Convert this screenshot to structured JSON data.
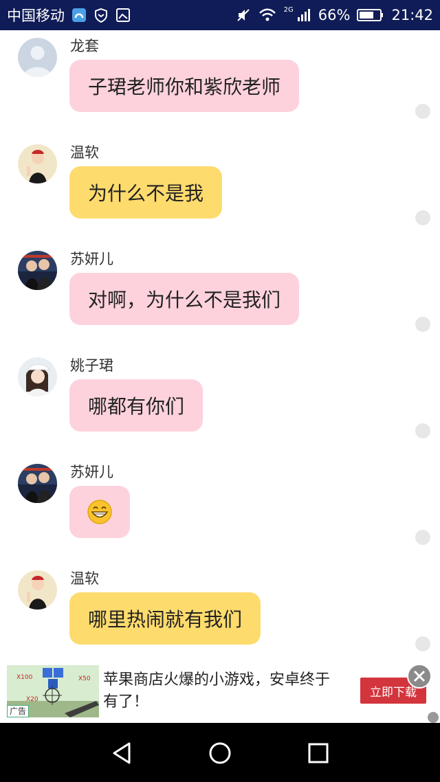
{
  "status_bar": {
    "carrier": "中国移动",
    "network": "2G",
    "battery": "66%",
    "time": "21:42",
    "icons": [
      "app-icon",
      "shield-icon",
      "gallery-icon",
      "mute-icon",
      "wifi-icon",
      "signal-icon",
      "battery-icon"
    ]
  },
  "messages": [
    {
      "sender": "龙套",
      "text": "子珺老师你和紫欣老师",
      "bubble_color": "#fdd2dc",
      "avatar": "default-avatar"
    },
    {
      "sender": "温软",
      "text": "为什么不是我",
      "bubble_color": "#fddb6d",
      "avatar": "girl-avatar"
    },
    {
      "sender": "苏妍儿",
      "text": "对啊，为什么不是我们",
      "bubble_color": "#fdd2dc",
      "avatar": "couple-avatar"
    },
    {
      "sender": "姚子珺",
      "text": "哪都有你们",
      "bubble_color": "#fdd2dc",
      "avatar": "girl-cap-avatar"
    },
    {
      "sender": "苏妍儿",
      "text": "😁",
      "bubble_color": "#fdd2dc",
      "avatar": "couple-avatar"
    },
    {
      "sender": "温软",
      "text": "哪里热闹就有我们",
      "bubble_color": "#fddb6d",
      "avatar": "girl-avatar"
    }
  ],
  "ad": {
    "tag": "广告",
    "text": "苹果商店火爆的小游戏，安卓终于有了！",
    "button": "立即下载",
    "game_labels": [
      "X100",
      "X50",
      "X20"
    ]
  },
  "colors": {
    "status_bar": "#101c57",
    "pink_bubble": "#fdd2dc",
    "yellow_bubble": "#fddb6d",
    "ad_button": "#d3353d",
    "nav_bar": "#000000"
  }
}
